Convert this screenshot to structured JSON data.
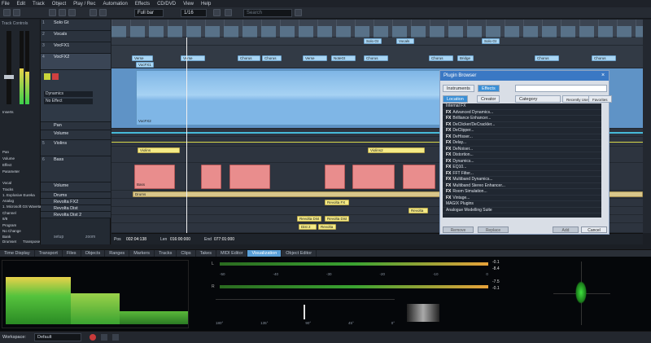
{
  "menu": [
    "File",
    "Edit",
    "Track",
    "Object",
    "Play / Rec",
    "Automation",
    "Effects",
    "CD/DVD",
    "View",
    "Help"
  ],
  "toolbar": {
    "zoom": "Full bar",
    "quant": "1/16",
    "search_placeholder": "Search"
  },
  "left": {
    "title": "Track Controls",
    "items": [
      "Inserts",
      "Pan",
      "Volume",
      "Effect",
      "Parameter",
      "Vocal",
      "Tracks",
      "1. Explosive Eureka",
      "Analog",
      "1. Microsoft GS Wavetable",
      "Channel",
      "8/8",
      "Program",
      "No Change",
      "Bank",
      "Drumset",
      "Transpose"
    ]
  },
  "tracks": [
    {
      "num": "1",
      "name": "Solo Gt"
    },
    {
      "num": "2",
      "name": "Vocals"
    },
    {
      "num": "3",
      "name": "VocFX1"
    },
    {
      "num": "4",
      "name": "VocFX2"
    },
    {
      "num": "5",
      "name": "Violins"
    },
    {
      "num": "6",
      "name": "Bass"
    },
    {
      "num": "7",
      "name": "Drums"
    },
    {
      "num": "8",
      "name": "Revolta FX2"
    },
    {
      "num": "9",
      "name": "Revolta Dist"
    },
    {
      "num": "10",
      "name": "Revolta Dist 2"
    }
  ],
  "track_panel": {
    "selected": "VocFX2",
    "dynamics": "Dynamics",
    "no_effect": "No Effect",
    "pan": "Pan",
    "volume": "Volume",
    "violins": "Violins",
    "bass": "Bass",
    "volume2": "Volume"
  },
  "arrange": {
    "markers": [
      "Solo Gt",
      "Vocals",
      "Verse",
      "Verse",
      "Chorus",
      "Chorus",
      "Verse",
      "NoteGt",
      "Chorus",
      "Chorus",
      "Bridge",
      "Chorus",
      "Chorus",
      "Chorus"
    ],
    "clip_labels": [
      "VocFX1",
      "VocFX2",
      "Violins",
      "Violins2",
      "Bass",
      "Drums",
      "Revolta FX",
      "Revolta Dist",
      "Revolta Dist 2",
      "Dist 2",
      "Revolta"
    ],
    "time_values": [
      "Pos",
      "002:04:138",
      "Len",
      "016:00:000",
      "End",
      "077:01:000"
    ]
  },
  "plugin_browser": {
    "title": "Plugin Browser",
    "tabs": [
      "Instruments",
      "Effects"
    ],
    "subtabs": [
      "Location",
      "Creator",
      "Category",
      "Recently Used",
      "Favorites"
    ],
    "items": [
      "Internal FX",
      "Advanced Dynamics...",
      "Brilliance Enhancer...",
      "DeClicker/DeCrackler...",
      "DeClipper...",
      "DeHisser...",
      "Delay...",
      "DeNoiser...",
      "Distortion...",
      "Dynamics...",
      "EQ10...",
      "FFT Filter...",
      "Multiband Dynamics...",
      "Multiband Stereo Enhancer...",
      "Room Simulation...",
      "Vintage...",
      "MAGIX Plugins",
      "Analogue Modelling Suite"
    ],
    "buttons": [
      "Remove",
      "Replace",
      "Add",
      "Cancel"
    ]
  },
  "dock_tabs": [
    "Time Display",
    "Transport",
    "Files",
    "Objects",
    "Ranges",
    "Markers",
    "Tracks",
    "Clips",
    "Takes",
    "MIDI Editor",
    "Visualization",
    "Object Editor"
  ],
  "active_dock_tab": "Visualization",
  "meters": {
    "l": "L",
    "r": "R",
    "scale": [
      "-50",
      "-40",
      "-30",
      "-20",
      "-10",
      "0"
    ],
    "peak_l": "-0.1",
    "rms_l": "-8.4",
    "peak_r": "-7.5",
    "rms_r": "-0.1",
    "corr_scale": [
      "180°",
      "135°",
      "90°",
      "45°",
      "0°"
    ]
  },
  "status": {
    "workspace_label": "Workspace:",
    "workspace": "Default",
    "zoom_label": "zoom"
  },
  "colors": {
    "accent": "#5aa0d8",
    "audio_clip": "#8fc4ee",
    "midi_clip": "#f4ea86",
    "bass_clip": "#e98d8d"
  }
}
